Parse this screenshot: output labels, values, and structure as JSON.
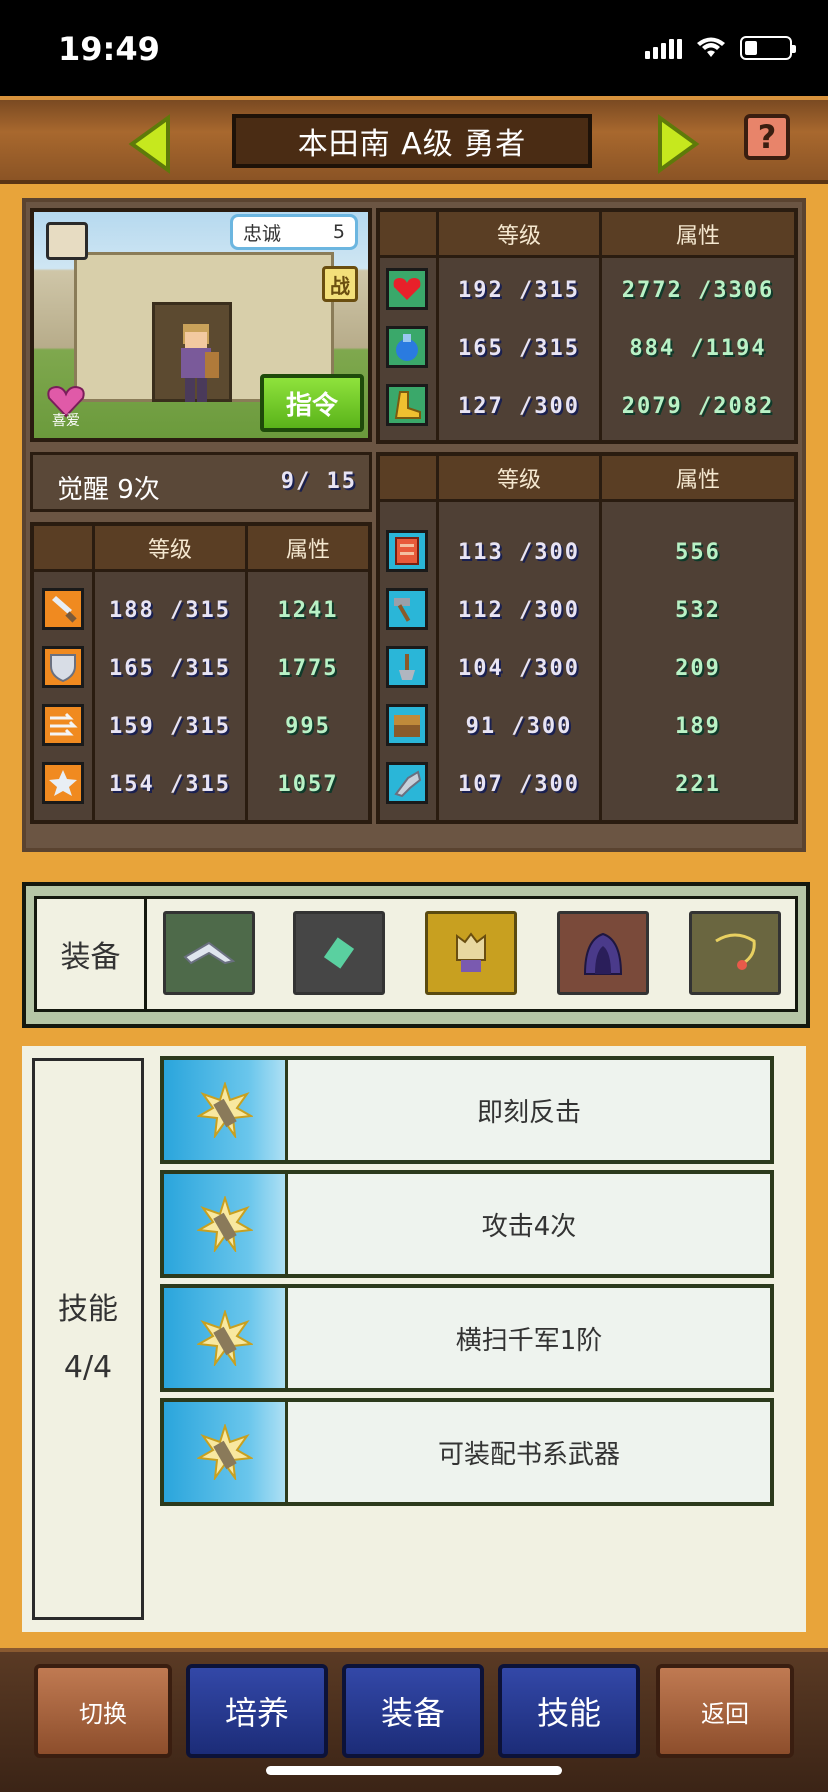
{
  "status_bar": {
    "time": "19:49"
  },
  "header": {
    "title": "本田南 A级 勇者",
    "help_label": "?"
  },
  "character": {
    "loyalty_label": "忠诚",
    "loyalty_value": "5",
    "battle_badge": "战",
    "like_label": "喜爱",
    "command_button": "指令"
  },
  "main_stats": {
    "col_level": "等级",
    "col_attr": "属性",
    "rows": [
      {
        "icon": "heart-icon",
        "level": "192 /315",
        "attr": "2772 /3306"
      },
      {
        "icon": "potion-icon",
        "level": "165 /315",
        "attr": "884 /1194"
      },
      {
        "icon": "boot-icon",
        "level": "127 /300",
        "attr": "2079 /2082"
      }
    ]
  },
  "awakening": {
    "label": "觉醒 9次",
    "value": "9/  15"
  },
  "combat_stats": {
    "col_level": "等级",
    "col_attr": "属性",
    "rows": [
      {
        "icon": "sword-icon",
        "level": "188 /315",
        "attr": "1241"
      },
      {
        "icon": "shield-icon",
        "level": "165 /315",
        "attr": "1775"
      },
      {
        "icon": "speed-icon",
        "level": "159 /315",
        "attr": "995"
      },
      {
        "icon": "star-icon",
        "level": "154 /315",
        "attr": "1057"
      }
    ]
  },
  "work_stats": {
    "col_level": "等级",
    "col_attr": "属性",
    "rows": [
      {
        "icon": "book-icon",
        "level": "113 /300",
        "attr": "556"
      },
      {
        "icon": "hammer-icon",
        "level": "112 /300",
        "attr": "532"
      },
      {
        "icon": "shovel-icon",
        "level": "104 /300",
        "attr": "209"
      },
      {
        "icon": "chest-icon",
        "level": "91 /300",
        "attr": "189"
      },
      {
        "icon": "gauntlet-icon",
        "level": "107 /300",
        "attr": "221"
      }
    ]
  },
  "equipment": {
    "label": "装备",
    "slots": [
      "claw-weapon-icon",
      "scroll-item-icon",
      "crown-armor-icon",
      "hood-icon",
      "necklace-icon"
    ]
  },
  "skills": {
    "label": "技能",
    "count": "4/4",
    "items": [
      "即刻反击",
      "攻击4次",
      "横扫千军1阶",
      "可装配书系武器"
    ]
  },
  "bottom_nav": {
    "switch": "切换",
    "train": "培养",
    "equip": "装备",
    "skill": "技能",
    "back": "返回"
  }
}
